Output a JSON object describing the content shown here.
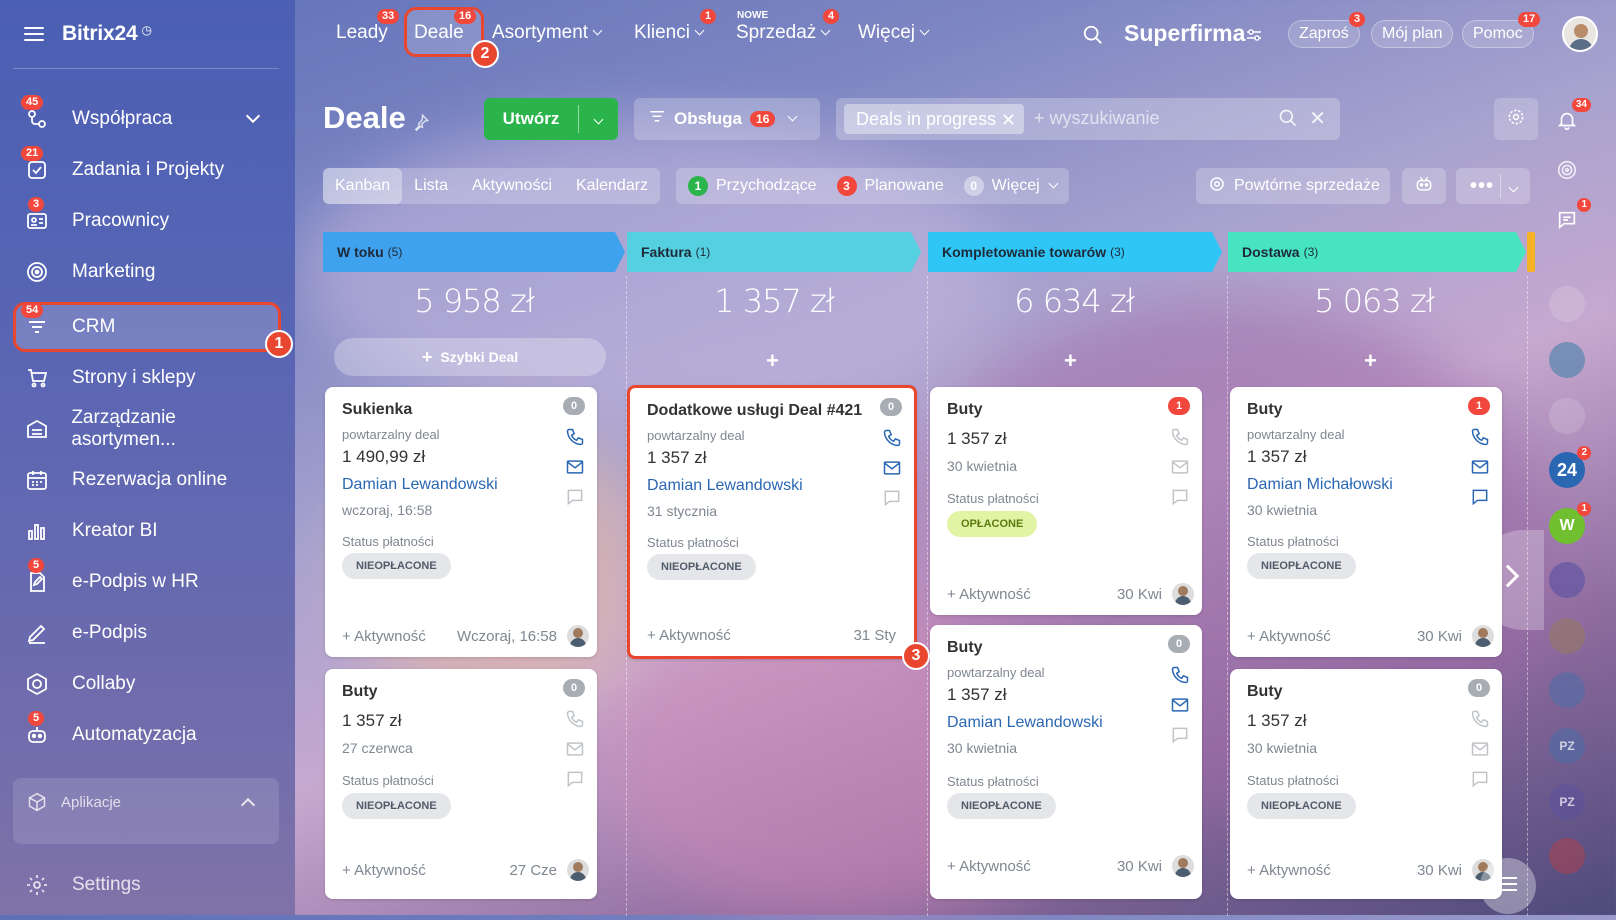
{
  "sidebar": {
    "logo": "Bitrix24",
    "items": [
      {
        "label": "Współpraca",
        "badge": "45",
        "icon": "collaboration-icon"
      },
      {
        "label": "Zadania i Projekty",
        "badge": "21",
        "icon": "tasks-icon"
      },
      {
        "label": "Pracownicy",
        "badge": "3",
        "icon": "employees-icon"
      },
      {
        "label": "Marketing",
        "badge": "",
        "icon": "marketing-icon"
      },
      {
        "label": "CRM",
        "badge": "54",
        "icon": "crm-icon"
      },
      {
        "label": "Strony i sklepy",
        "badge": "",
        "icon": "cart-icon"
      },
      {
        "label": "Zarządzanie asortymen...",
        "badge": "",
        "icon": "inventory-icon"
      },
      {
        "label": "Rezerwacja online",
        "badge": "",
        "icon": "calendar-icon"
      },
      {
        "label": "Kreator BI",
        "badge": "",
        "icon": "bar-chart-icon"
      },
      {
        "label": "e-Podpis w HR",
        "badge": "5",
        "icon": "hr-signature-icon"
      },
      {
        "label": "e-Podpis",
        "badge": "",
        "icon": "pen-icon"
      },
      {
        "label": "Collaby",
        "badge": "",
        "icon": "collaby-icon"
      },
      {
        "label": "Automatyzacja",
        "badge": "5",
        "icon": "robot-icon"
      }
    ],
    "apps_label": "Aplikacje",
    "settings_label": "Settings"
  },
  "steps": {
    "one": "1",
    "two": "2",
    "three": "3"
  },
  "topbar": {
    "tabs": [
      {
        "label": "Leady",
        "badge": "33"
      },
      {
        "label": "Deale",
        "badge": "16"
      },
      {
        "label": "Asortyment",
        "badge": ""
      },
      {
        "label": "Klienci",
        "badge": "1"
      },
      {
        "label": "Sprzedaż",
        "badge": "4",
        "note": "NOWE"
      },
      {
        "label": "Więcej",
        "badge": ""
      }
    ],
    "company": "Superfirma",
    "invite": {
      "label": "Zaproś",
      "badge": "3"
    },
    "plan": "Mój plan",
    "help": {
      "label": "Pomoc",
      "badge": "17"
    }
  },
  "header": {
    "title": "Deale",
    "create": "Utwórz",
    "pipeline": {
      "label": "Obsługa",
      "badge": "16"
    },
    "filter_chip": "Deals in progress",
    "search_placeholder": "+ wyszukiwanie"
  },
  "views": {
    "tabs": [
      "Kanban",
      "Lista",
      "Aktywności",
      "Kalendarz"
    ],
    "counters": [
      {
        "num": "1",
        "label": "Przychodzące",
        "color": "#2bb44c"
      },
      {
        "num": "3",
        "label": "Planowane",
        "color": "#f2473c"
      },
      {
        "num": "0",
        "label": "Więcej",
        "color": "#c5c9cf"
      }
    ],
    "repeat_sales": "Powtórne sprzedaże"
  },
  "columns": [
    {
      "title": "W toku",
      "count": "(5)",
      "sum": "5 958 zł",
      "color": "#3ea2ee",
      "quick": "Szybki Deal",
      "cards": [
        {
          "title": "Sukienka",
          "sub": "powtarzalny deal",
          "price": "1 490,99 zł",
          "person": "Damian Lewandowski",
          "date": "wczoraj, 16:58",
          "status_label": "Status płatności",
          "status": "NIEOPŁACONE",
          "activity": "+ Aktywność",
          "time": "Wczoraj, 16:58",
          "badge": "0"
        },
        {
          "title": "Buty",
          "sub": "",
          "price": "1 357 zł",
          "person": "",
          "date": "27 czerwca",
          "status_label": "Status płatności",
          "status": "NIEOPŁACONE",
          "activity": "+ Aktywność",
          "time": "27 Cze",
          "badge": "0"
        }
      ]
    },
    {
      "title": "Faktura",
      "count": "(1)",
      "sum": "1 357 zł",
      "color": "#55d0e0",
      "cards": [
        {
          "title": "Dodatkowe usługi Deal #421",
          "sub": "powtarzalny deal",
          "price": "1 357 zł",
          "person": "Damian Lewandowski",
          "date": "31 stycznia",
          "status_label": "Status płatności",
          "status": "NIEOPŁACONE",
          "activity": "+ Aktywność",
          "time": "31 Sty",
          "badge": "0"
        }
      ]
    },
    {
      "title": "Kompletowanie towarów",
      "count": "(3)",
      "sum": "6 634 zł",
      "color": "#2fc6f6",
      "cards": [
        {
          "title": "Buty",
          "sub": "",
          "price": "1 357 zł",
          "person": "",
          "date": "30 kwietnia",
          "status_label": "Status płatności",
          "status": "OPŁACONE",
          "activity": "+ Aktywność",
          "time": "30 Kwi",
          "badge": "1"
        },
        {
          "title": "Buty",
          "sub": "powtarzalny deal",
          "price": "1 357 zł",
          "person": "Damian Lewandowski",
          "date": "30 kwietnia",
          "status_label": "Status płatności",
          "status": "NIEOPŁACONE",
          "activity": "+ Aktywność",
          "time": "30 Kwi",
          "badge": "0"
        }
      ]
    },
    {
      "title": "Dostawa",
      "count": "(3)",
      "sum": "5 063 zł",
      "color": "#47e4c2",
      "cards": [
        {
          "title": "Buty",
          "sub": "powtarzalny deal",
          "price": "1 357 zł",
          "person": "Damian Michałowski",
          "date": "30 kwietnia",
          "status_label": "Status płatności",
          "status": "NIEOPŁACONE",
          "activity": "+ Aktywność",
          "time": "30 Kwi",
          "badge": "1"
        },
        {
          "title": "Buty",
          "sub": "",
          "price": "1 357 zł",
          "person": "",
          "date": "30 kwietnia",
          "status_label": "Status płatności",
          "status": "NIEOPŁACONE",
          "activity": "+ Aktywność",
          "time": "30 Kwi",
          "badge": "0"
        }
      ]
    }
  ],
  "rail": {
    "bell_badge": "34",
    "chat_badge": "1",
    "b24_badge": "2",
    "w_badge": "1",
    "w_letter": "W",
    "b24_label": "24",
    "pz": "PZ"
  },
  "colors": {
    "accent_green": "#2bb44c",
    "badge_red": "#f2473c",
    "highlight": "#e8462f",
    "link": "#2a67b3"
  }
}
